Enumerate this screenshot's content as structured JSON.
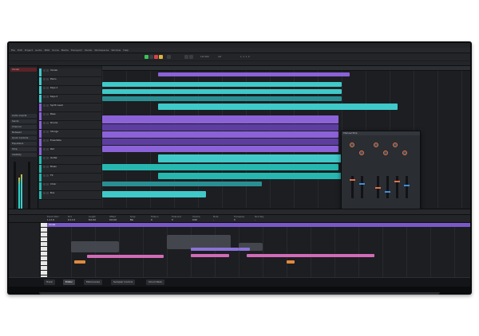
{
  "window": {
    "title": "Cubase"
  },
  "menu": [
    "File",
    "Edit",
    "Project",
    "Audio",
    "MIDI",
    "Score",
    "Media",
    "Transport",
    "Studio",
    "Workspaces",
    "Window",
    "Help"
  ],
  "transport": {
    "tempo": "120.000",
    "signature": "4/4",
    "position": "1. 1. 1. 0"
  },
  "inspector": {
    "track_name": "Vocals",
    "sections": [
      "Audio Inserts",
      "Sends",
      "Channel",
      "Notepad",
      "Quick Controls",
      "Equalizers",
      "Strip",
      "Visibility"
    ],
    "bottom_items": [
      "Mix Console"
    ]
  },
  "tracks": [
    {
      "name": "Vocals",
      "color": "#3fc9c9"
    },
    {
      "name": "Piano",
      "color": "#3fc9c9"
    },
    {
      "name": "Keys 1",
      "color": "#3fc9c9"
    },
    {
      "name": "Keys 2",
      "color": "#3fc9c9"
    },
    {
      "name": "Synth Lead",
      "color": "#8c62d8"
    },
    {
      "name": "Bass",
      "color": "#8c62d8"
    },
    {
      "name": "Drums",
      "color": "#8c62d8"
    },
    {
      "name": "Strings",
      "color": "#8c62d8"
    },
    {
      "name": "Ensemble",
      "color": "#8c62d8"
    },
    {
      "name": "Pad",
      "color": "#8c62d8"
    },
    {
      "name": "Guitar",
      "color": "#26b8b0"
    },
    {
      "name": "Brass",
      "color": "#26b8b0"
    },
    {
      "name": "FX",
      "color": "#26b8b0"
    },
    {
      "name": "Choir",
      "color": "#26b8b0"
    },
    {
      "name": "Bus",
      "color": "#26b8b0"
    }
  ],
  "plugin": {
    "title": "Channel Strip"
  },
  "editor": {
    "columns": [
      {
        "label": "Event Start",
        "value": "1.1.1.0"
      },
      {
        "label": "End",
        "value": "9.1.1.0"
      },
      {
        "label": "Length",
        "value": "8.0.0.0"
      },
      {
        "label": "Offset",
        "value": "0.0.0.0"
      },
      {
        "label": "Snap",
        "value": "Bar"
      },
      {
        "label": "Fade-In",
        "value": "0"
      },
      {
        "label": "Fade-Out",
        "value": "0"
      },
      {
        "label": "Volume",
        "value": "0.00"
      },
      {
        "label": "Mute",
        "value": "-"
      },
      {
        "label": "Transpose",
        "value": "0"
      },
      {
        "label": "Root Key",
        "value": "-"
      }
    ],
    "ruler_label": "Vocals"
  },
  "bottom_tabs": [
    "Track",
    "Editor",
    "MixConsole",
    "Sampler Control",
    "Chord Pads"
  ],
  "colors": {
    "cyan": "#3fc9c9",
    "purple": "#8c62d8",
    "teal": "#26b8b0",
    "pink": "#d26bb8",
    "orange": "#e08a3e"
  }
}
